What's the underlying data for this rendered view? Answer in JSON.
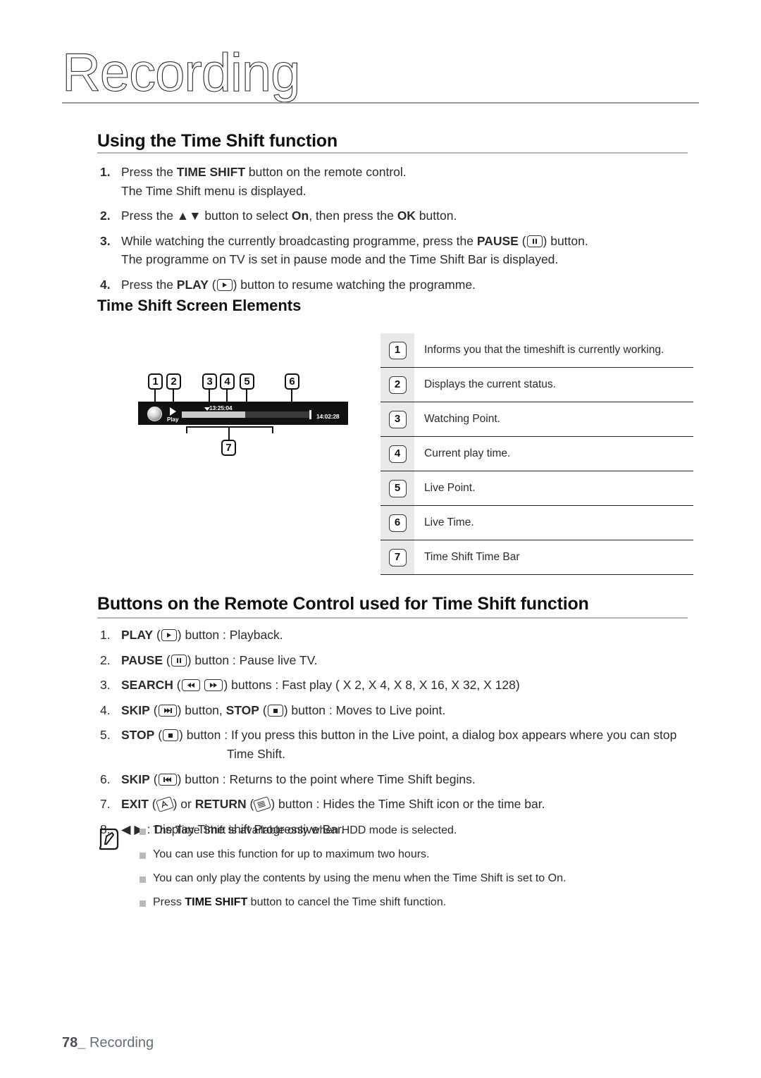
{
  "chapter": {
    "title": "Recording"
  },
  "section1": {
    "heading": "Using the Time Shift function",
    "steps": [
      {
        "num": "1.",
        "line1_a": "Press the ",
        "line1_b": "TIME SHIFT",
        "line1_c": " button on the remote control.",
        "line2": "The Time Shift menu is displayed."
      },
      {
        "num": "2.",
        "a": "Press the ",
        "arrows": "▲▼",
        "b": " button to select ",
        "bold1": "On",
        "c": ", then press the ",
        "bold2": "OK",
        "d": " button."
      },
      {
        "num": "3.",
        "a": "While watching the currently broadcasting programme, press the ",
        "bold1": "PAUSE",
        "icon": "pause-key-icon",
        "b": " button.",
        "line2": "The programme on TV is set in pause mode and the Time Shift Bar is displayed."
      },
      {
        "num": "4.",
        "a": "Press the ",
        "bold1": "PLAY",
        "icon": "play-key-icon",
        "b": " button to resume watching the programme."
      }
    ]
  },
  "section2": {
    "heading": "Time Shift Screen Elements",
    "diagram": {
      "status_label": "Play",
      "current_play_time": "13:25:04",
      "live_time": "14:02:28",
      "callouts": [
        "1",
        "2",
        "3",
        "4",
        "5",
        "6",
        "7"
      ]
    },
    "legend": [
      {
        "num": "1",
        "text": "Informs you that the timeshift is currently working."
      },
      {
        "num": "2",
        "text": "Displays the current status."
      },
      {
        "num": "3",
        "text": "Watching Point."
      },
      {
        "num": "4",
        "text": "Current play time."
      },
      {
        "num": "5",
        "text": "Live Point."
      },
      {
        "num": "6",
        "text": "Live Time."
      },
      {
        "num": "7",
        "text": "Time Shift Time Bar"
      }
    ]
  },
  "section3": {
    "heading": "Buttons on the Remote Control used for Time Shift function",
    "items": [
      {
        "num": "1.",
        "bold1": "PLAY",
        "icon1": "play-key-icon",
        "rest": " button : Playback."
      },
      {
        "num": "2.",
        "bold1": "PAUSE",
        "icon1": "pause-key-icon",
        "rest": " button : Pause live TV."
      },
      {
        "num": "3.",
        "bold1": "SEARCH",
        "icon1": "rewind-key-icon",
        "icon2": "fastforward-key-icon",
        "rest": " buttons : Fast play ( X 2, X 4, X 8, X 16, X 32, X 128)"
      },
      {
        "num": "4.",
        "bold1": "SKIP",
        "icon1": "skip-next-key-icon",
        "mid": " button, ",
        "bold2": "STOP",
        "icon2": "stop-key-icon",
        "rest": " button : Moves to Live point."
      },
      {
        "num": "5.",
        "bold1": "STOP",
        "icon1": "stop-key-icon",
        "rest": " button : If you press this button in the Live point, a dialog box appears where you can stop",
        "line2": "Time Shift."
      },
      {
        "num": "6.",
        "bold1": "SKIP",
        "icon1": "skip-prev-key-icon",
        "rest": " button : Returns to the point where Time Shift begins."
      },
      {
        "num": "7.",
        "bold1": "EXIT",
        "icon1": "exit-key-icon",
        "mid": " or ",
        "bold2": "RETURN",
        "icon2": "return-key-icon",
        "rest": " button : Hides the Time Shift icon or the time bar."
      },
      {
        "num": "8.",
        "arrows": "◀ ▶",
        "rest": " : Display Time shift Progressive Bar."
      }
    ]
  },
  "notes": {
    "icon": "note-pen-icon",
    "items": [
      {
        "a": "The Time Shift is available only when HDD mode is selected."
      },
      {
        "a": "You can use this function for up to maximum two hours."
      },
      {
        "a": "You can only play the contents by using the menu when the Time Shift is set to On."
      },
      {
        "a": "Press ",
        "bold": "TIME SHIFT",
        "b": " button to cancel the Time shift function."
      }
    ]
  },
  "footer": {
    "page": "78",
    "underscore": "_",
    "section": "Recording"
  }
}
